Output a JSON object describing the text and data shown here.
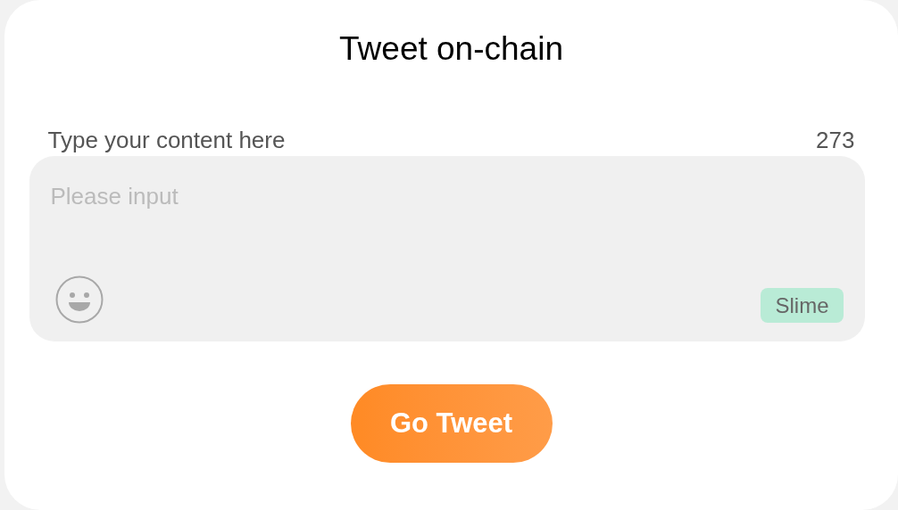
{
  "title": "Tweet on-chain",
  "field_label": "Type your content here",
  "char_count": "273",
  "content_field": {
    "placeholder": "Please input"
  },
  "tag": "Slime",
  "button": "Go Tweet"
}
